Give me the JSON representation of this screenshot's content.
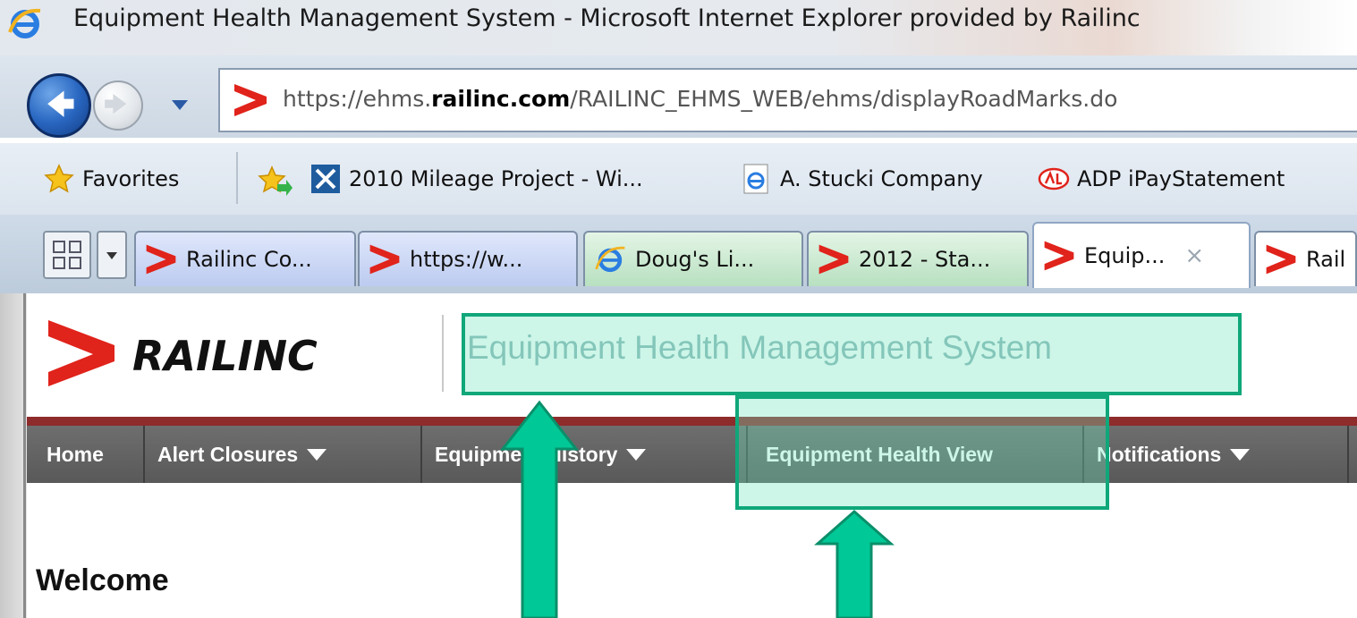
{
  "window": {
    "title": "Equipment Health Management System - Microsoft Internet Explorer provided by Railinc"
  },
  "address_bar": {
    "url_prefix": "https://ehms.",
    "url_domain": "railinc.com",
    "url_path": "/RAILINC_EHMS_WEB/ehms/displayRoadMarks.do"
  },
  "favorites_bar": {
    "favorites_label": "Favorites",
    "items": [
      {
        "label": "2010 Mileage Project - Wi...",
        "icon": "sharepoint-icon"
      },
      {
        "label": "A. Stucki Company",
        "icon": "ie-page-icon"
      },
      {
        "label": "ADP iPayStatement",
        "icon": "adp-icon"
      }
    ]
  },
  "tabs": [
    {
      "label": "Railinc Co...",
      "icon": "railinc-icon",
      "color": "blue"
    },
    {
      "label": "https://w...",
      "icon": "railinc-icon",
      "color": "blue"
    },
    {
      "label": "Doug's Li...",
      "icon": "ie-page-icon",
      "color": "green"
    },
    {
      "label": "2012 - Sta...",
      "icon": "railinc-icon",
      "color": "green"
    },
    {
      "label": "Equip...",
      "icon": "railinc-icon",
      "color": "active",
      "close": "×"
    },
    {
      "label": "Rail",
      "icon": "railinc-icon",
      "color": "white"
    }
  ],
  "header": {
    "logo_text": "RAILINC",
    "app_title": "Equipment Health Management System"
  },
  "menu": {
    "items": [
      {
        "label": "Home",
        "has_dropdown": false
      },
      {
        "label": "Alert Closures",
        "has_dropdown": true
      },
      {
        "label": "Equipment History",
        "has_dropdown": true
      },
      {
        "label": "Equipment Health View",
        "has_dropdown": false
      },
      {
        "label": "Notifications",
        "has_dropdown": true
      }
    ]
  },
  "main": {
    "heading": "Welcome"
  },
  "colors": {
    "brand_red": "#e0231b",
    "menu_bg": "#636363",
    "menu_band": "#8e2b2b",
    "highlight": "#10a77a",
    "arrow": "#00c896"
  }
}
